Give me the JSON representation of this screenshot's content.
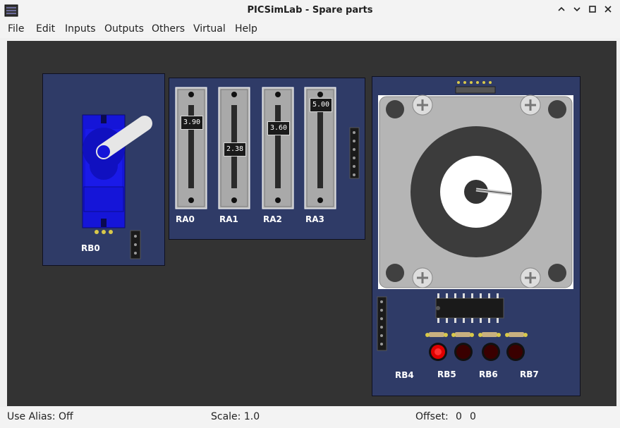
{
  "window": {
    "title": "PICSimLab - Spare parts",
    "controls": [
      "chevron-up-icon",
      "chevron-down-icon",
      "maximize-icon",
      "close-icon"
    ]
  },
  "menu": {
    "items": [
      "File",
      "Edit",
      "Inputs",
      "Outputs",
      "Others",
      "Virtual",
      "Help"
    ]
  },
  "parts": {
    "servo": {
      "label": "RB0"
    },
    "potentiometers": [
      {
        "label": "RA0",
        "value": "3.90"
      },
      {
        "label": "RA1",
        "value": "2.38"
      },
      {
        "label": "RA2",
        "value": "3.60"
      },
      {
        "label": "RA3",
        "value": "5.00"
      }
    ],
    "stepper": {
      "label": "RB4"
    },
    "leds": [
      {
        "label": "RB5",
        "color": "#e00000"
      },
      {
        "label": "RB6",
        "color": "#3a0000"
      },
      {
        "label": "RB7",
        "color": "#3a0000"
      }
    ]
  },
  "status": {
    "alias": "Use Alias: Off",
    "scale": "Scale: 1.0",
    "offset_label": "Offset:",
    "offset_x": "0",
    "offset_y": "0"
  },
  "colors": {
    "board": "#2f3b67",
    "canvas": "#333333",
    "servo": "#1515d8",
    "pin": "#d8c84a"
  }
}
